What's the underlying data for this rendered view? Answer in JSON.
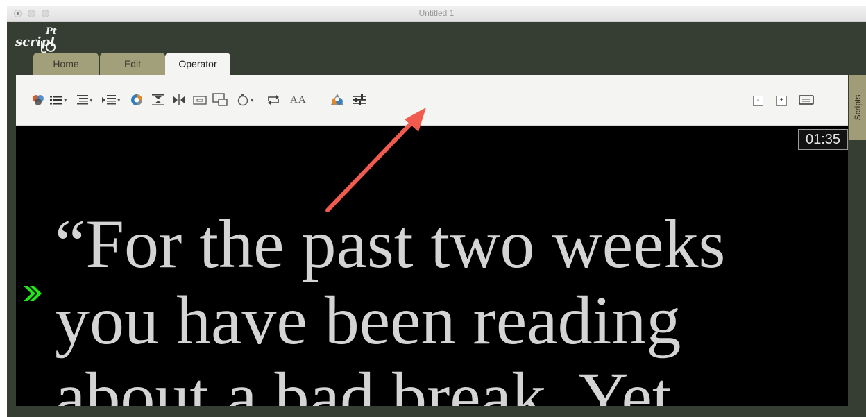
{
  "window": {
    "title": "Untitled 1"
  },
  "logo": {
    "wordmark": "script",
    "superscript": "Pt"
  },
  "tabs": [
    {
      "label": "Home",
      "active": false
    },
    {
      "label": "Edit",
      "active": false
    },
    {
      "label": "Operator",
      "active": true
    }
  ],
  "toolbar": {
    "icons": [
      "colors-icon",
      "list-icon",
      "line-spacing-icon",
      "indent-icon",
      "color-wheel-icon",
      "collapse-vertical-icon",
      "mirror-icon",
      "screen-icon",
      "output-display-icon",
      "timer-icon",
      "loop-icon",
      "font-size-icon",
      "operator-colors-icon",
      "sliders-settings-icon"
    ],
    "font_size_label": "AA",
    "zoom_out_label": "-",
    "zoom_in_label": "+"
  },
  "side_panel": {
    "label": "Scripts"
  },
  "prompter": {
    "timer": "01:35",
    "cue_marker": "double-chevron-right-icon",
    "lines": [
      "“For the past two weeks",
      "you have been reading",
      "about a bad break. Yet"
    ]
  },
  "colors": {
    "background": "#363d33",
    "tab_inactive": "#a29f7b",
    "toolbar": "#f4f4f2",
    "screen": "#000000",
    "script_text": "#d4d4d4",
    "cue_marker": "#22e61a",
    "annotation_arrow": "#f05a4f"
  }
}
